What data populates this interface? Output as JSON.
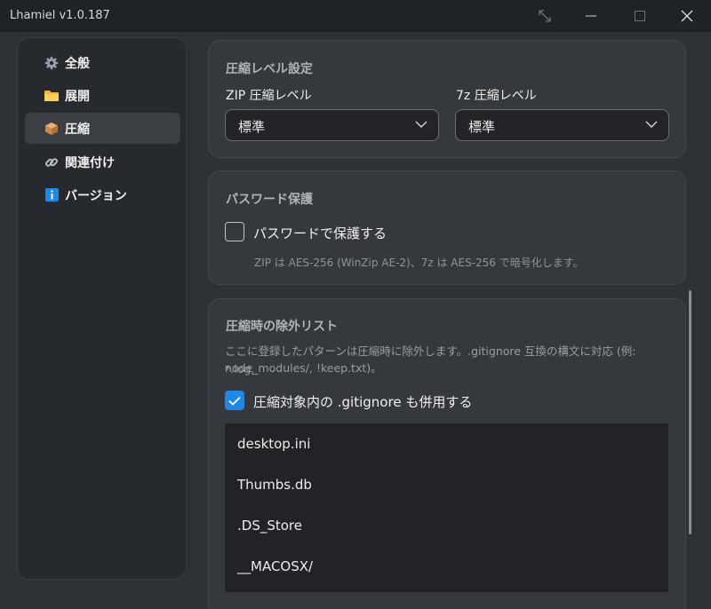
{
  "window": {
    "title": "Lhamiel v1.0.187"
  },
  "sidebar": {
    "items": [
      {
        "label": "全般",
        "icon": "gear-icon"
      },
      {
        "label": "展開",
        "icon": "folder-icon"
      },
      {
        "label": "圧縮",
        "icon": "package-icon",
        "active": true
      },
      {
        "label": "関連付け",
        "icon": "link-icon"
      },
      {
        "label": "バージョン",
        "icon": "info-icon"
      }
    ]
  },
  "compression_level": {
    "title": "圧縮レベル設定",
    "zip_label": "ZIP 圧縮レベル",
    "zip_value": "標準",
    "sevenz_label": "7z 圧縮レベル",
    "sevenz_value": "標準"
  },
  "password": {
    "title": "パスワード保護",
    "checkbox_label": "パスワードで保護する",
    "checked": false,
    "note": "ZIP は AES-256 (WinZip AE-2)、7z は AES-256 で暗号化します。"
  },
  "exclusion": {
    "title": "圧縮時の除外リスト",
    "description_line1": "ここに登録したパターンは圧縮時に除外します。.gitignore 互換の構文に対応 (例: *.log,",
    "description_line2": "node_modules/, !keep.txt)。",
    "gitignore_label": "圧縮対象内の .gitignore も併用する",
    "gitignore_checked": true,
    "patterns": [
      "desktop.ini",
      "Thumbs.db",
      ".DS_Store",
      "__MACOSX/"
    ]
  },
  "colors": {
    "accent": "#1e88e5",
    "window_bg": "#2e3136",
    "card_bg": "#35383d"
  }
}
